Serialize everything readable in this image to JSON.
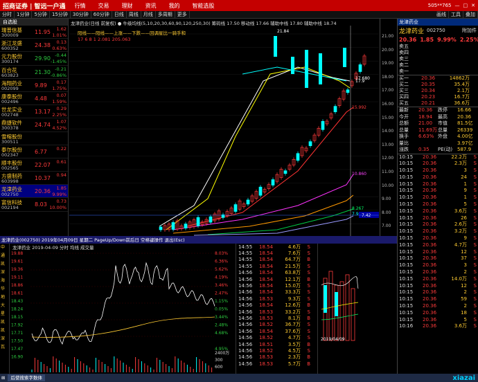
{
  "titlebar": {
    "brand": "招商证券 | 智远一户通",
    "menu": [
      "行情",
      "交易",
      "理财",
      "资讯",
      "我的",
      "智能选股"
    ],
    "status": "505**765"
  },
  "toolbar": {
    "periods": [
      "分时",
      "1分钟",
      "5分钟",
      "15分钟",
      "30分钟",
      "60分钟",
      "日线",
      "周线",
      "月线",
      "多周期",
      "更多"
    ],
    "right": [
      "画线",
      "工具",
      "叠加"
    ]
  },
  "watchlist": {
    "header": "自选股",
    "items": [
      {
        "name": "瑞普信基",
        "code": "300009",
        "price": "11.95",
        "pct": "1.62",
        "pct2": "1.01%",
        "cls": "up"
      },
      {
        "name": "浙江龙盛",
        "code": "600352",
        "price": "24.38",
        "pct": "0.13",
        "pct2": "0.63%",
        "cls": "up"
      },
      {
        "name": "元力股份",
        "code": "300174",
        "price": "29.90",
        "pct": "-0.44",
        "pct2": "-1.45%",
        "cls": "dn"
      },
      {
        "name": "百合花",
        "code": "603823",
        "price": "21.30",
        "pct": "-0.21",
        "pct2": "-0.86%",
        "cls": "dn"
      },
      {
        "name": "海翔药业",
        "code": "002099",
        "price": "9.89",
        "pct": "0.17",
        "pct2": "1.75%",
        "cls": "up"
      },
      {
        "name": "康泰股份",
        "code": "002496",
        "price": "4.48",
        "pct": "0.07",
        "pct2": "1.59%",
        "cls": "up"
      },
      {
        "name": "世龙实业",
        "code": "002748",
        "price": "13.17",
        "pct": "0.29",
        "pct2": "2.25%",
        "cls": "up"
      },
      {
        "name": "鼎捷软件",
        "code": "300378",
        "price": "24.74",
        "pct": "1.07",
        "pct2": "4.52%",
        "cls": "up"
      },
      {
        "name": "雪榕股份",
        "code": "300511",
        "price": "",
        "pct": "",
        "pct2": "",
        "cls": "up"
      },
      {
        "name": "泰尔股份",
        "code": "002347",
        "price": "6.77",
        "pct": "0.22",
        "pct2": "",
        "cls": "up"
      },
      {
        "name": "顺丰股份",
        "code": "002565",
        "price": "22.07",
        "pct": "0.61",
        "pct2": "",
        "cls": "up"
      },
      {
        "name": "方盛制药",
        "code": "603998",
        "price": "10.37",
        "pct": "0.94",
        "pct2": "",
        "cls": "up"
      },
      {
        "name": "龙津药业",
        "code": "002750",
        "price": "20.36",
        "pct": "1.85",
        "pct2": "9.99%",
        "cls": "up"
      },
      {
        "name": "富信科技",
        "code": "002194",
        "price": "8.03",
        "pct": "0.73",
        "pct2": "10.00%",
        "cls": "up"
      }
    ]
  },
  "main_chart": {
    "header": "龙津药业(日线 前复权)  ● 牛级均线(5,10,20,30,60,90,120,250,30)  筹码线 17.50 移动线 17.66  辅助中线 17.80  辅助中线 18.74",
    "legend": "阳线——阳线——上涨——下跌——回调星比一骑手和",
    "row3": "17    6    8    1    2.081    205.063",
    "labels": {
      "hi": "21.84",
      "r1": "17.9",
      "r2": "17.680",
      "r3": "15.992",
      "l1": "10.860",
      "l2": "8.267",
      "l3": "7.908",
      "cur": "7.42"
    }
  },
  "yaxis": [
    "21.00",
    "20.00",
    "19.00",
    "18.00",
    "17.00",
    "16.00",
    "15.00",
    "14.00",
    "13.00",
    "12.00",
    "11.00",
    "10.00",
    "9.00",
    "8.00",
    "7.00"
  ],
  "quote": {
    "header": "龙津药业",
    "title": "龙津药业",
    "code": "002750",
    "gf": "附加件",
    "price": "20.36",
    "chg": "1.85",
    "pct": "9.99%",
    "pct2": "2.25%",
    "sells": [
      [
        "卖五",
        "",
        ""
      ],
      [
        "卖四",
        "",
        ""
      ],
      [
        "卖三",
        "",
        ""
      ],
      [
        "卖二",
        "",
        ""
      ],
      [
        "卖一",
        "",
        ""
      ]
    ],
    "buys": [
      [
        "买一",
        "20.36",
        "14862万"
      ],
      [
        "买二",
        "20.35",
        "35.4万"
      ],
      [
        "买三",
        "20.34",
        "2.1万"
      ],
      [
        "买四",
        "20.23",
        "16.7万"
      ],
      [
        "买五",
        "20.21",
        "36.6万"
      ]
    ],
    "stats": [
      [
        "最新",
        "20.36",
        "跌停",
        "16.66"
      ],
      [
        "今开",
        "18.94",
        "最高",
        "20.36"
      ],
      [
        "总额",
        "21.00",
        "市值",
        "81.5亿"
      ],
      [
        "总量",
        "11.69万",
        "总量",
        "26339"
      ],
      [
        "换手",
        "6.63%",
        "外盘",
        "4.00亿"
      ],
      [
        "量比",
        "",
        "",
        "3.97亿"
      ],
      [
        "涨跌",
        "0.35",
        "PE(动)",
        "587.9"
      ]
    ],
    "ticks": [
      [
        "10:15",
        "20.36",
        "22.2万",
        "S"
      ],
      [
        "10:15",
        "20.36",
        "2.3万",
        "S"
      ],
      [
        "10:15",
        "20.36",
        "3",
        "S"
      ],
      [
        "10:15",
        "20.36",
        "24",
        "S"
      ],
      [
        "10:15",
        "20.36",
        "1",
        "S"
      ],
      [
        "10:15",
        "20.36",
        "9",
        "S"
      ],
      [
        "10:15",
        "20.36",
        "1",
        "S"
      ],
      [
        "10:15",
        "20.36",
        "5",
        "S"
      ],
      [
        "10:15",
        "20.36",
        "3.6万",
        "S"
      ],
      [
        "10:15",
        "20.36",
        "26",
        "S"
      ],
      [
        "10:15",
        "20.36",
        "2.6万",
        "S"
      ],
      [
        "10:15",
        "20.36",
        "3.2万",
        "S"
      ],
      [
        "10:15",
        "20.36",
        "9",
        "S"
      ],
      [
        "10:15",
        "20.36",
        "4.7万",
        "S"
      ],
      [
        "10:15",
        "20.36",
        "12",
        "S"
      ],
      [
        "10:15",
        "20.36",
        "37",
        "S"
      ],
      [
        "10:15",
        "20.36",
        "3",
        "S"
      ],
      [
        "10:15",
        "20.36",
        "2",
        "S"
      ],
      [
        "10:15",
        "20.36",
        "14.0万",
        "S"
      ],
      [
        "10:15",
        "20.36",
        "12",
        "S"
      ],
      [
        "10:15",
        "20.36",
        "2",
        "S"
      ],
      [
        "10:15",
        "20.36",
        "59",
        "S"
      ],
      [
        "10:15",
        "20.36",
        "2",
        "S"
      ],
      [
        "10:15",
        "20.36",
        "18",
        "S"
      ],
      [
        "10:15",
        "20.36",
        "5",
        "S"
      ],
      [
        "10:16",
        "20.36",
        "3.6万",
        "S"
      ]
    ]
  },
  "lower": {
    "header": "龙津药业(002750) 2019年04月09日 星期二 PageUp/Down前后日 空格键操作 退出(Esc)",
    "sub": "龙津药业  2019-04-09 分时 均线 成交量",
    "left_tags": [
      "中",
      "通",
      "凯",
      "深",
      "海",
      "华",
      "地",
      "大",
      "星",
      "凯",
      "凯",
      "深",
      "瓦"
    ],
    "yl": [
      "19.88",
      "19.61",
      "19.36",
      "19.11",
      "18.86",
      "18.61",
      "18.43",
      "18.24",
      "18.15",
      "17.92",
      "17.71",
      "17.50",
      "17.47",
      "16.90"
    ],
    "yr": [
      "8.03%",
      "6.36%",
      "5.62%",
      "4.19%",
      "3.46%",
      "2.47%",
      "1.15%",
      "0.05%",
      "3.44%",
      "2.48%",
      "4.68%",
      "",
      "4.95%",
      ""
    ],
    "vol": [
      "2400万",
      "300",
      "600"
    ]
  },
  "tickmid": [
    [
      "14:55",
      "18.54",
      "4.6万",
      "S"
    ],
    [
      "14:55",
      "18.54",
      "7.6万",
      "S"
    ],
    [
      "14:55",
      "18.54",
      "64.7万",
      "B"
    ],
    [
      "14:55",
      "18.54",
      "21.5万",
      "S"
    ],
    [
      "14:56",
      "18.54",
      "63.8万",
      "S"
    ],
    [
      "14:56",
      "18.54",
      "12.1万",
      "B"
    ],
    [
      "14:56",
      "18.54",
      "15.0万",
      "S"
    ],
    [
      "14:56",
      "18.54",
      "33.3万",
      "S"
    ],
    [
      "14:56",
      "18.53",
      "9.3万",
      "S"
    ],
    [
      "14:56",
      "18.54",
      "12.6万",
      "B"
    ],
    [
      "14:56",
      "18.53",
      "33.2万",
      "S"
    ],
    [
      "14:56",
      "18.53",
      "8.1万",
      "B"
    ],
    [
      "14:56",
      "18.52",
      "36.7万",
      "S"
    ],
    [
      "14:56",
      "18.54",
      "37.6万",
      "S"
    ],
    [
      "14:56",
      "18.52",
      "4.7万",
      "S"
    ],
    [
      "14:56",
      "18.51",
      "3.5万",
      "B"
    ],
    [
      "14:56",
      "18.52",
      "4.5万",
      "S"
    ],
    [
      "14:56",
      "18.53",
      "2.3万",
      "B"
    ],
    [
      "14:56",
      "18.53",
      "5.7万",
      "B"
    ]
  ],
  "mini": {
    "label": "2019/04/09"
  },
  "taskbar": {
    "items": [
      "后使搜索字数体",
      "",
      "",
      "",
      ""
    ],
    "wm": "xiazai"
  }
}
